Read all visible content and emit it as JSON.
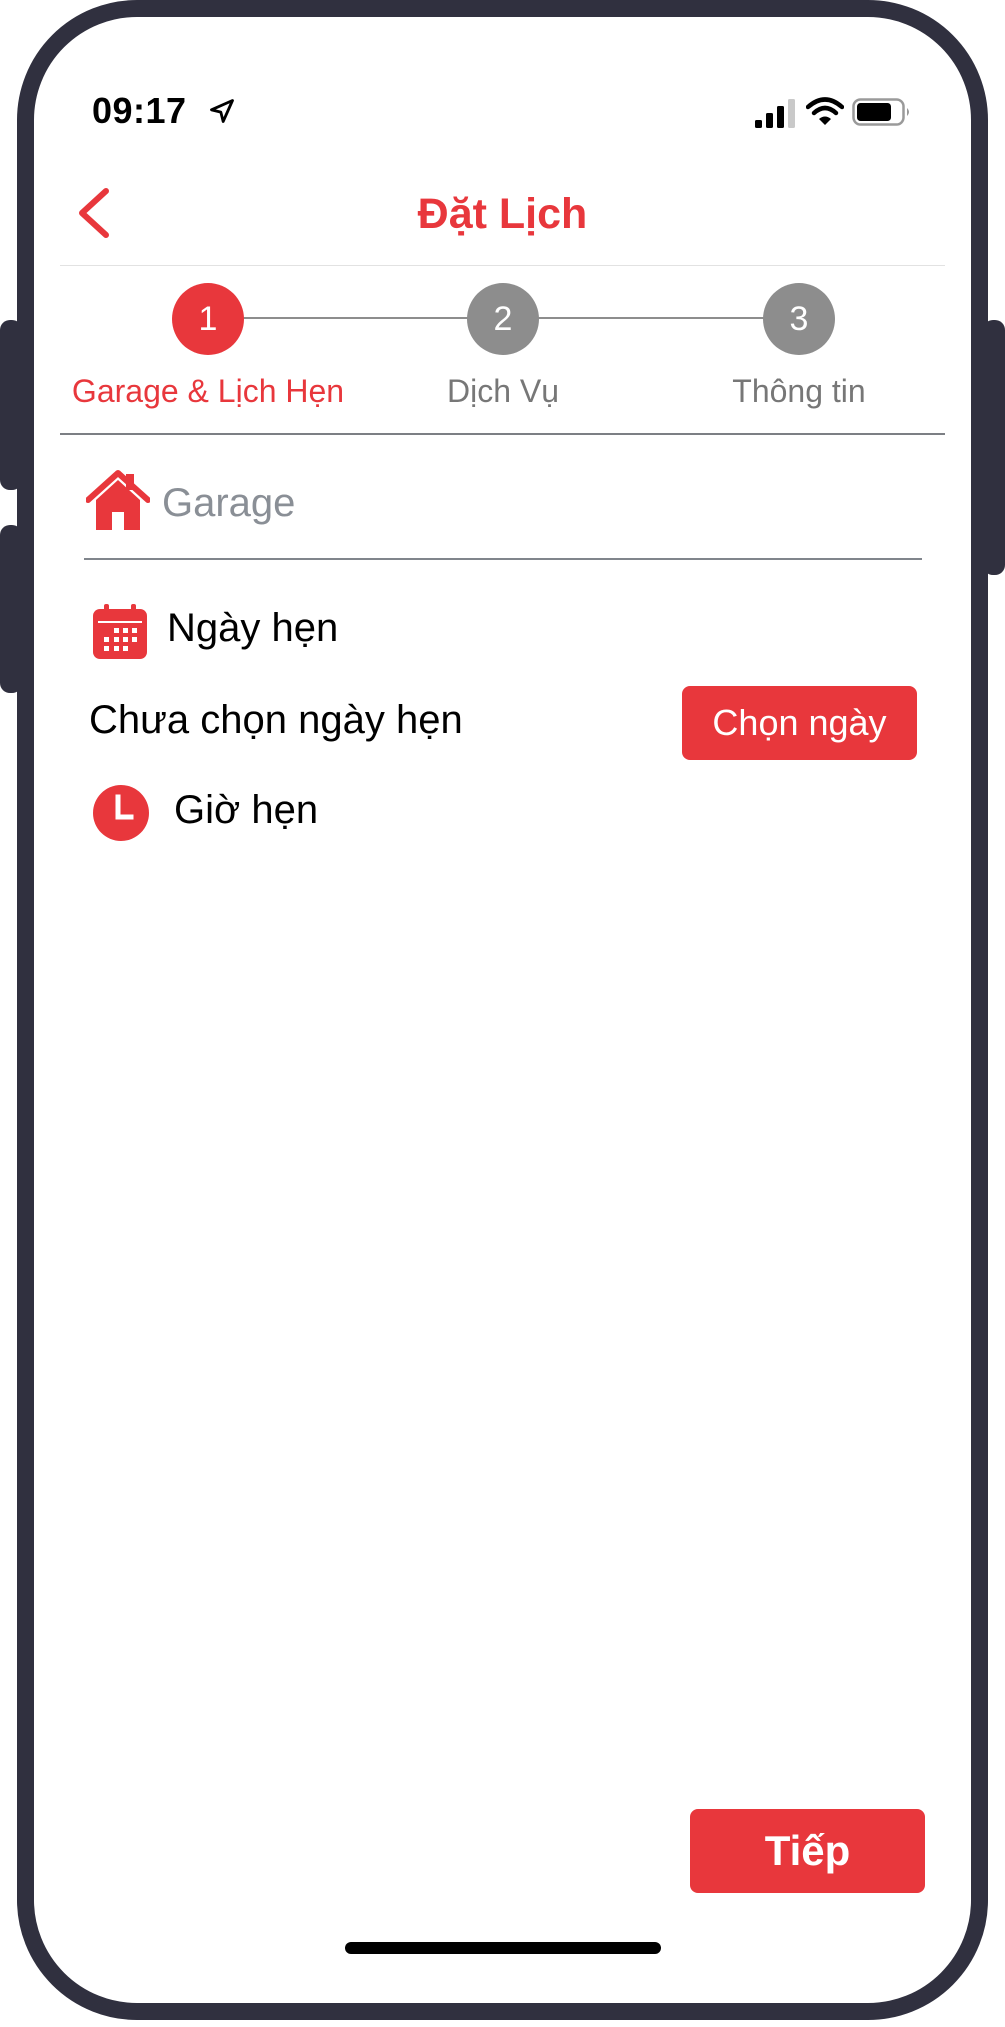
{
  "status_bar": {
    "time": "09:17",
    "location_icon": "location-arrow-icon",
    "signal_icon": "cellular-signal-icon",
    "wifi_icon": "wifi-icon",
    "battery_icon": "battery-icon"
  },
  "header": {
    "title": "Đặt Lịch",
    "back_icon": "chevron-left-icon"
  },
  "stepper": {
    "current_step": 1,
    "steps": [
      {
        "number": "1",
        "label": "Garage & Lịch Hẹn"
      },
      {
        "number": "2",
        "label": "Dịch Vụ"
      },
      {
        "number": "3",
        "label": "Thông tin"
      }
    ]
  },
  "form": {
    "garage": {
      "placeholder": "Garage",
      "icon": "home-icon"
    },
    "date": {
      "label": "Ngày hẹn",
      "icon": "calendar-icon",
      "status": "Chưa chọn ngày hẹn",
      "button_label": "Chọn ngày"
    },
    "time": {
      "label": "Giờ hẹn",
      "icon": "clock-icon"
    }
  },
  "footer": {
    "next_label": "Tiếp"
  },
  "colors": {
    "accent": "#e8373c",
    "step_inactive": "#8d8d8d",
    "step_label_inactive": "#777777",
    "frame": "#30303f",
    "placeholder": "#8a8f96"
  }
}
